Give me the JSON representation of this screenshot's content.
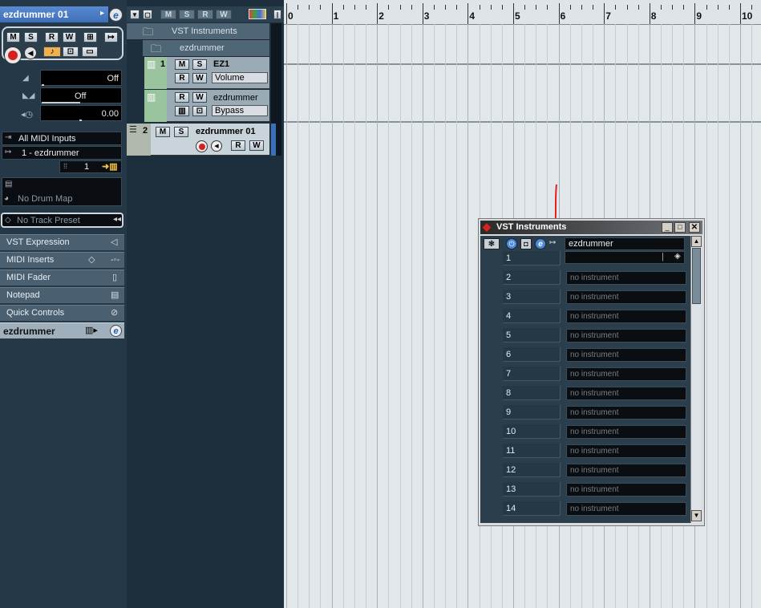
{
  "inspector": {
    "track_name": "ezdrummer 01",
    "buttons": [
      "M",
      "S",
      "R",
      "W"
    ],
    "volume_value": "Off",
    "pan_value": "Off",
    "delay_value": "0.00",
    "midi_input": "All MIDI Inputs",
    "midi_output": "1 - ezdrummer",
    "channel": "1",
    "drum_map": "No Drum Map",
    "track_preset": "No Track Preset",
    "sections": [
      "VST Expression",
      "MIDI Inserts",
      "MIDI Fader",
      "Notepad",
      "Quick Controls"
    ],
    "instrument_section": "ezdrummer"
  },
  "toolbar": {
    "buttons": [
      "M",
      "S",
      "R",
      "W"
    ]
  },
  "tracks": {
    "folder_vst": "VST Instruments",
    "folder_ez": "ezdrummer",
    "track1_num": "1",
    "track1_name": "EZ1",
    "track1_param": "Volume",
    "track1b_name": "ezdrummer",
    "track1b_param": "Bypass",
    "track2_num": "2",
    "track2_name": "ezdrummer 01",
    "btn_m": "M",
    "btn_s": "S",
    "btn_r": "R",
    "btn_w": "W"
  },
  "ruler": {
    "labels": [
      "0",
      "1",
      "2",
      "3",
      "4",
      "5",
      "6",
      "7",
      "8",
      "9",
      "10"
    ]
  },
  "vst_window": {
    "title": "VST Instruments",
    "slot1_instrument": "ezdrummer",
    "slots": [
      {
        "num": "1",
        "instrument": ""
      },
      {
        "num": "2",
        "instrument": "no instrument"
      },
      {
        "num": "3",
        "instrument": "no instrument"
      },
      {
        "num": "4",
        "instrument": "no instrument"
      },
      {
        "num": "5",
        "instrument": "no instrument"
      },
      {
        "num": "6",
        "instrument": "no instrument"
      },
      {
        "num": "7",
        "instrument": "no instrument"
      },
      {
        "num": "8",
        "instrument": "no instrument"
      },
      {
        "num": "9",
        "instrument": "no instrument"
      },
      {
        "num": "10",
        "instrument": "no instrument"
      },
      {
        "num": "11",
        "instrument": "no instrument"
      },
      {
        "num": "12",
        "instrument": "no instrument"
      },
      {
        "num": "13",
        "instrument": "no instrument"
      },
      {
        "num": "14",
        "instrument": "no instrument"
      }
    ]
  },
  "colors": {
    "accent": "#5b8fd6",
    "record": "#d32020",
    "annotation": "#e02020"
  }
}
